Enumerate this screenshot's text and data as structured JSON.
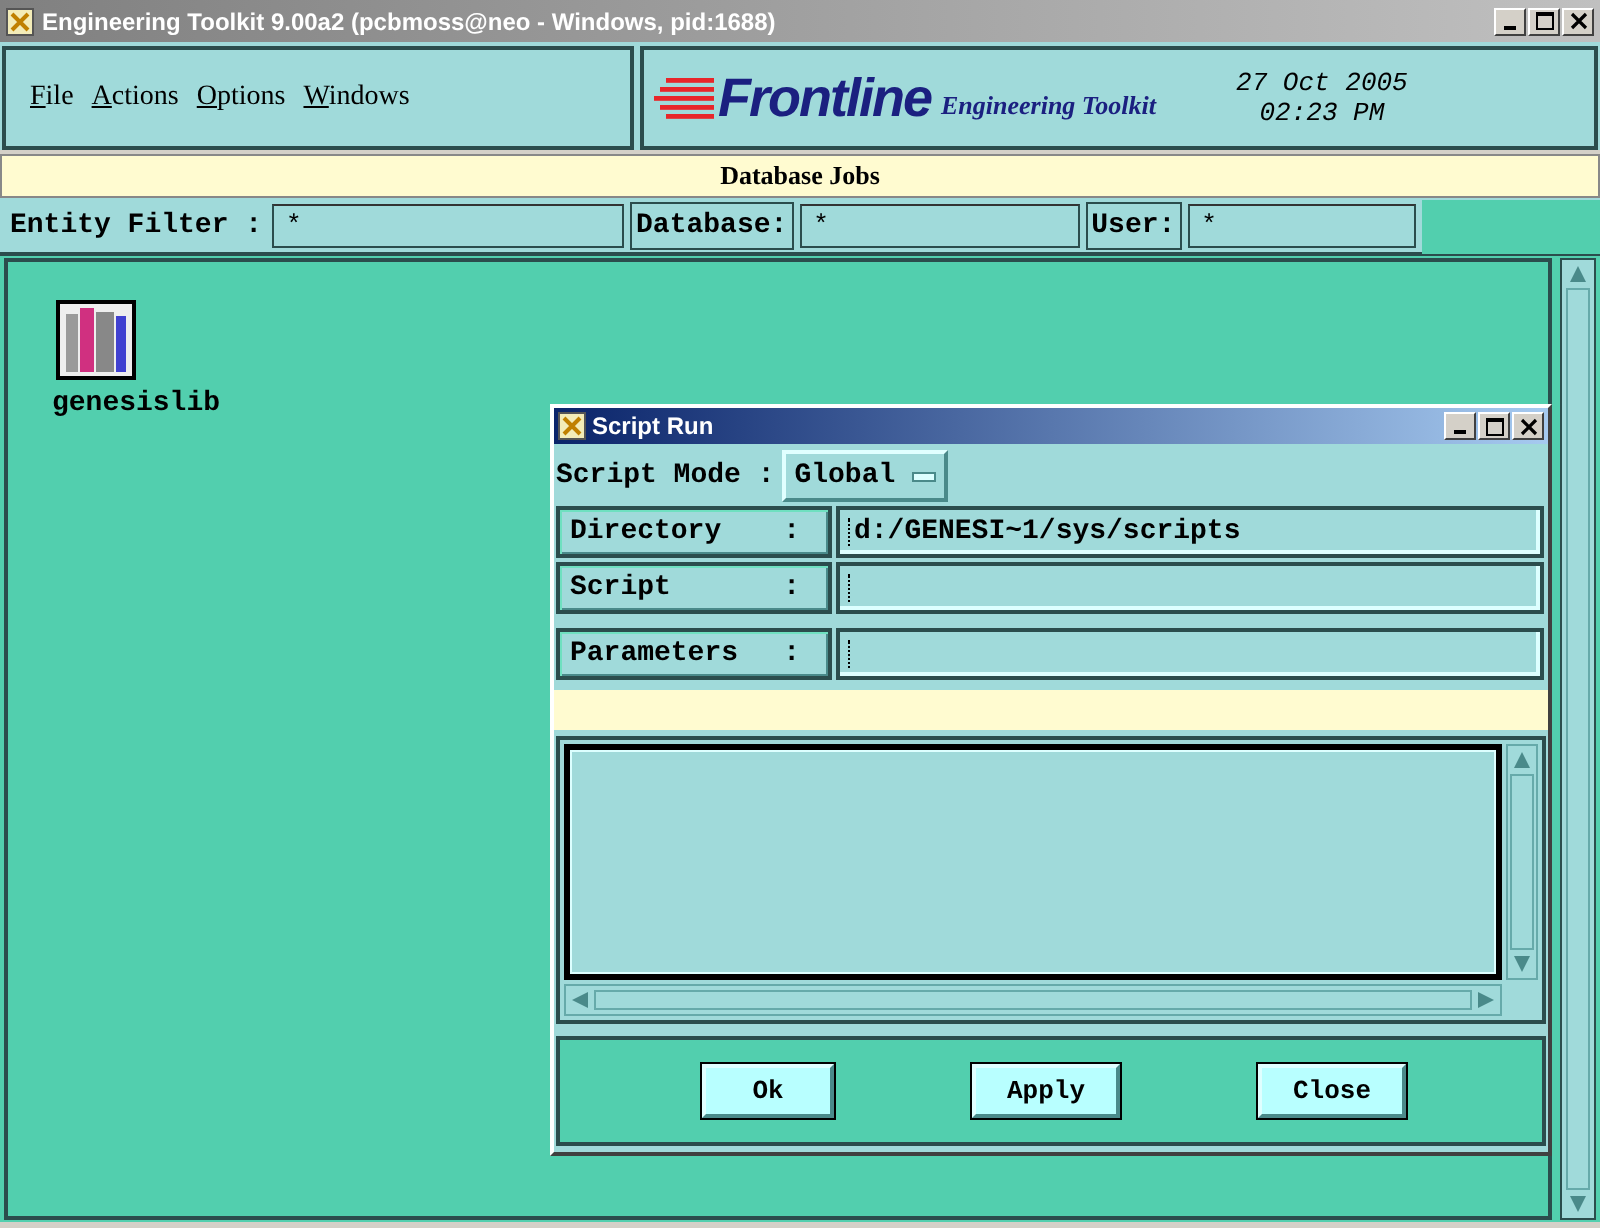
{
  "window": {
    "title": "Engineering Toolkit 9.00a2 (pcbmoss@neo - Windows, pid:1688)"
  },
  "menu": [
    "File",
    "Actions",
    "Options",
    "Windows"
  ],
  "logo": {
    "name": "Frontline",
    "subtitle": "Engineering Toolkit"
  },
  "date": "27 Oct 2005",
  "time": "02:23 PM",
  "banner": "Database Jobs",
  "filters": [
    {
      "label": "Entity Filter :",
      "value": "*"
    },
    {
      "label": "Database:",
      "value": "*"
    },
    {
      "label": "User:",
      "value": "*"
    }
  ],
  "desktop_items": [
    {
      "label": "genesislib"
    }
  ],
  "dialog": {
    "title": "Script Run",
    "mode_label": "Script Mode :",
    "mode": "Global",
    "fields": [
      {
        "label": "Directory",
        "colon": ":",
        "value": "d:/GENESI~1/sys/scripts"
      },
      {
        "label": "Script",
        "colon": ":"
      },
      {
        "label": "Parameters",
        "colon": ":"
      }
    ],
    "buttons": [
      "Ok",
      "Apply",
      "Close"
    ]
  }
}
